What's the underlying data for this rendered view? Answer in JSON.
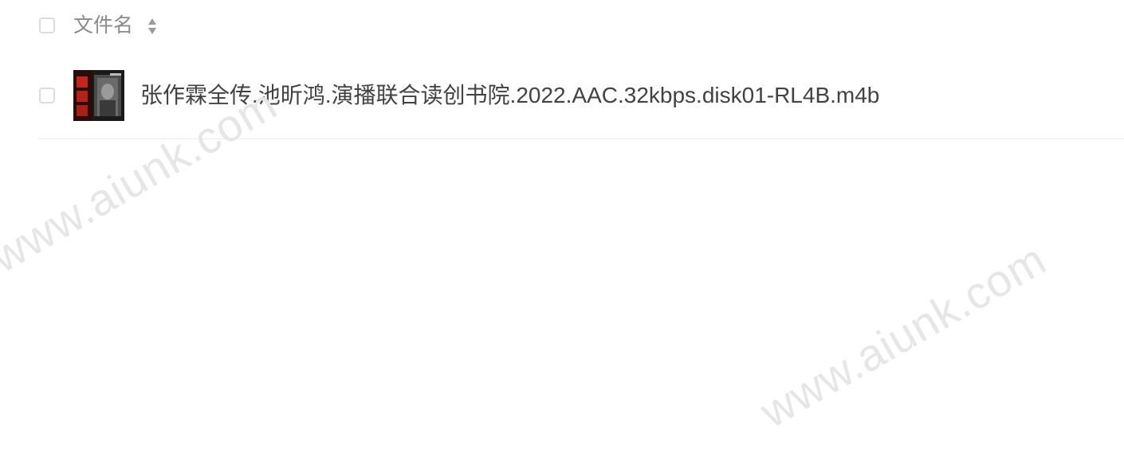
{
  "header": {
    "column_label": "文件名",
    "sort_icon": "sort-updown-icon"
  },
  "files": [
    {
      "name": "张作霖全传.池昕鸿.演播联合读创书院.2022.AAC.32kbps.disk01-RL4B.m4b",
      "thumbnail_icon": "album-cover-thumbnail"
    }
  ],
  "watermarks": [
    "www.aiunk.com",
    "www.aiunk.com"
  ],
  "colors": {
    "header_text": "#8a8a8a",
    "file_text": "#424242",
    "checkbox_border": "#dcdcdc",
    "divider": "#ececec",
    "watermark": "#e6e6e6"
  }
}
